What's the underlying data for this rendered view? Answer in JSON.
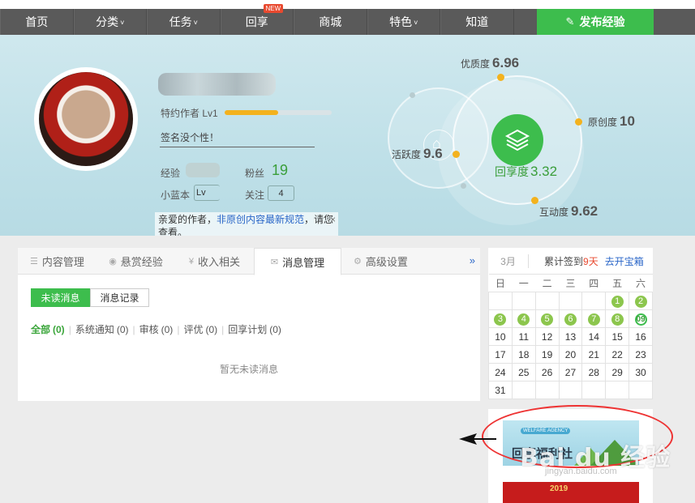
{
  "nav": {
    "items": [
      {
        "label": "首页",
        "caret": false
      },
      {
        "label": "分类",
        "caret": true
      },
      {
        "label": "任务",
        "caret": true
      },
      {
        "label": "回享",
        "caret": false,
        "badge": "NEW"
      },
      {
        "label": "商城",
        "caret": false
      },
      {
        "label": "特色",
        "caret": true
      },
      {
        "label": "知道",
        "caret": false
      }
    ],
    "caret_glyph": "˅",
    "publish_label": "发布经验"
  },
  "profile": {
    "level_label": "特约作者 Lv1",
    "level_progress": 0.5,
    "signature": "签名没个性！",
    "exp_label": "经验",
    "fans_label": "粉丝",
    "fans_count": "19",
    "xiaolanben_label": "小蓝本",
    "xiaolanben_value": "Lv",
    "follow_label": "关注",
    "follow_count": "4",
    "notice_prefix": "亲爱的作者，",
    "notice_link": "非原创内容最新规范",
    "notice_suffix": "，请您查看。",
    "notice_close": "×"
  },
  "metrics": {
    "quality_label": "优质度",
    "quality_value": "6.96",
    "originality_label": "原创度",
    "originality_value": "10",
    "activity_label": "活跃度",
    "activity_value": "9.6",
    "huixiang_label": "回享度",
    "huixiang_value": "3.32",
    "interaction_label": "互动度",
    "interaction_value": "9.62"
  },
  "tabs": [
    {
      "label": "内容管理",
      "icon": "list-icon",
      "active": false
    },
    {
      "label": "悬赏经验",
      "icon": "reward-icon",
      "active": false
    },
    {
      "label": "收入相关",
      "icon": "yen-icon",
      "active": false
    },
    {
      "label": "消息管理",
      "icon": "mail-icon",
      "active": true
    },
    {
      "label": "高级设置",
      "icon": "gear-icon",
      "active": false
    }
  ],
  "tabs_more": "»",
  "messages": {
    "unread_button": "未读消息",
    "record_button": "消息记录",
    "filters": [
      {
        "label": "全部",
        "count": "(0)",
        "active": true
      },
      {
        "label": "系统通知",
        "count": "(0)",
        "active": false
      },
      {
        "label": "审核",
        "count": "(0)",
        "active": false
      },
      {
        "label": "评优",
        "count": "(0)",
        "active": false
      },
      {
        "label": "回享计划",
        "count": "(0)",
        "active": false
      }
    ],
    "empty_text": "暂无未读消息"
  },
  "calendar": {
    "month": "3月",
    "signed_prefix": "累计签到",
    "signed_days": "9天",
    "open_box": "去开宝箱",
    "weekdays": [
      "日",
      "一",
      "二",
      "三",
      "四",
      "五",
      "六"
    ],
    "weeks": [
      [
        "",
        "",
        "",
        "",
        "",
        "1",
        "2"
      ],
      [
        "3",
        "4",
        "5",
        "6",
        "7",
        "8",
        "09"
      ],
      [
        "10",
        "11",
        "12",
        "13",
        "14",
        "15",
        "16"
      ],
      [
        "17",
        "18",
        "19",
        "20",
        "21",
        "22",
        "23"
      ],
      [
        "24",
        "25",
        "26",
        "27",
        "28",
        "29",
        "30"
      ],
      [
        "31",
        "",
        "",
        "",
        "",
        "",
        ""
      ]
    ],
    "checked_days": [
      "1",
      "2",
      "3",
      "4",
      "5",
      "6",
      "7",
      "8"
    ],
    "today": "09"
  },
  "ads": {
    "welfare_tag": "WELFARE AGENCY",
    "welfare_text": "回享福利社",
    "newyear_text": "2019"
  },
  "watermark": {
    "main": "Bai du 经验",
    "sub": "jingyan.baidu.com"
  }
}
